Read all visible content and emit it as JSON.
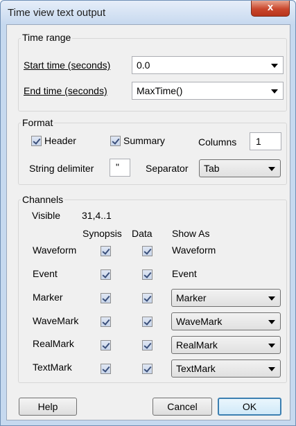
{
  "window": {
    "title": "Time view text output",
    "close_label": "x"
  },
  "time_range": {
    "label": "Time range",
    "start_label": "Start time (seconds)",
    "start_value": "0.0",
    "end_label": "End time (seconds)",
    "end_value": "MaxTime()"
  },
  "format": {
    "label": "Format",
    "header_label": "Header",
    "header_checked": true,
    "summary_label": "Summary",
    "summary_checked": true,
    "columns_label": "Columns",
    "columns_value": "1",
    "string_delim_label": "String delimiter",
    "string_delim_value": "\"",
    "separator_label": "Separator",
    "separator_value": "Tab"
  },
  "channels": {
    "label": "Channels",
    "visible_label": "Visible",
    "visible_value": "31,4..1",
    "col_synopsis": "Synopsis",
    "col_data": "Data",
    "col_show_as": "Show As",
    "rows": [
      {
        "name": "Waveform",
        "synopsis": true,
        "data": true,
        "show_as": "Waveform"
      },
      {
        "name": "Event",
        "synopsis": true,
        "data": true,
        "show_as": "Event"
      },
      {
        "name": "Marker",
        "synopsis": true,
        "data": true,
        "show_as": "Marker"
      },
      {
        "name": "WaveMark",
        "synopsis": true,
        "data": true,
        "show_as": "WaveMark"
      },
      {
        "name": "RealMark",
        "synopsis": true,
        "data": true,
        "show_as": "RealMark"
      },
      {
        "name": "TextMark",
        "synopsis": true,
        "data": true,
        "show_as": "TextMark"
      }
    ]
  },
  "buttons": {
    "help": "Help",
    "cancel": "Cancel",
    "ok": "OK"
  }
}
